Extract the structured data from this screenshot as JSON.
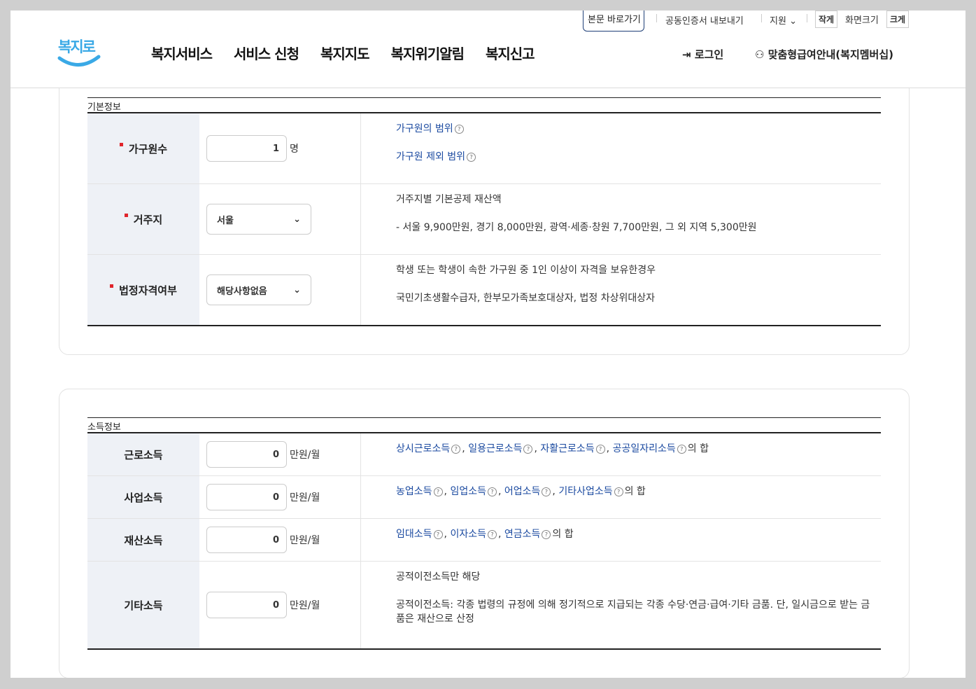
{
  "header": {
    "logo_text": "복지로",
    "nav": [
      "복지서비스",
      "서비스 신청",
      "복지지도",
      "복지위기알림",
      "복지신고"
    ],
    "utility": {
      "skip": "본문 바로가기",
      "cert": "공동인증서 내보내기",
      "support": "지원",
      "font_small": "작게",
      "font_label": "화면크기",
      "font_large": "크게"
    },
    "login": "로그인",
    "member": "맞춤형급여안내(복지멤버십)"
  },
  "basic": {
    "title": "기본정보",
    "household": {
      "label": "가구원수",
      "value": "1",
      "unit": "명",
      "link1": "가구원의 범위",
      "link2": "가구원 제외 범위"
    },
    "residence": {
      "label": "거주지",
      "value": "서울",
      "desc_title": "거주지별 기본공제 재산액",
      "desc_text": "- 서울 9,900만원, 경기 8,000만원, 광역·세종·창원 7,700만원, 그 외 지역 5,300만원"
    },
    "qualification": {
      "label": "법정자격여부",
      "value": "해당사항없음",
      "desc1": "학생 또는 학생이 속한 가구원 중 1인 이상이 자격을 보유한경우",
      "desc2": "국민기초생활수급자, 한부모가족보호대상자, 법정 차상위대상자"
    }
  },
  "income": {
    "title": "소득정보",
    "unit": "만원/월",
    "work": {
      "label": "근로소득",
      "value": "0",
      "links": [
        "상시근로소득",
        "일용근로소득",
        "자활근로소득",
        "공공일자리소득"
      ],
      "suffix": "의 합"
    },
    "business": {
      "label": "사업소득",
      "value": "0",
      "links": [
        "농업소득",
        "임업소득",
        "어업소득",
        "기타사업소득"
      ],
      "suffix": "의 합"
    },
    "property": {
      "label": "재산소득",
      "value": "0",
      "links": [
        "임대소득",
        "이자소득",
        "연금소득"
      ],
      "suffix": "의 합"
    },
    "other": {
      "label": "기타소득",
      "value": "0",
      "desc1": "공적이전소득만 해당",
      "desc2": "공적이전소득: 각종 법령의 규정에 의해 정기적으로 지급되는 각종 수당·연금·급여·기타 금품. 단, 일시금으로 받는 금품은 재산으로 산정"
    }
  },
  "colors": {
    "accent": "#1b4aa0",
    "required": "#e0242b",
    "label_bg": "#eef1f6",
    "logo": "#3aa9e6"
  }
}
